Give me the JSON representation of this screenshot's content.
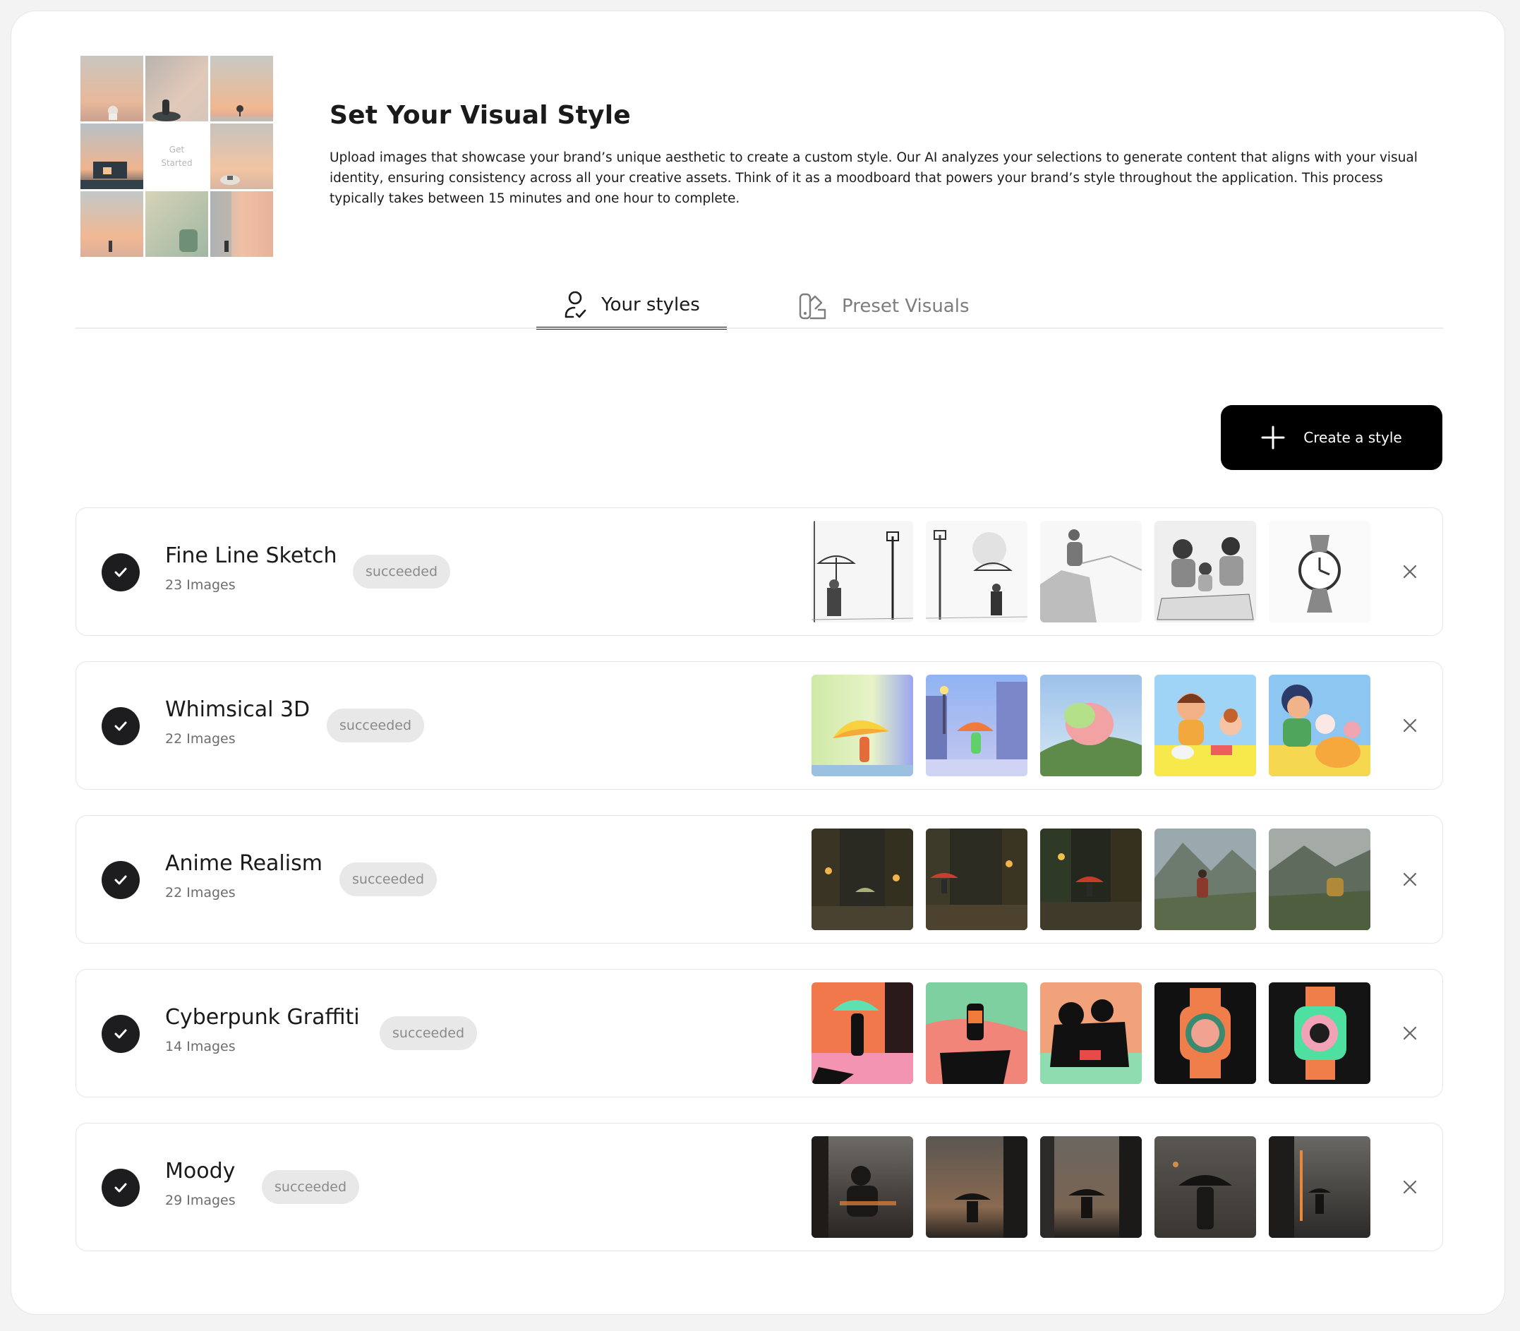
{
  "header": {
    "title": "Set Your Visual Style",
    "description": "Upload images that showcase your brand’s unique aesthetic to create a custom style. Our AI analyzes your selections to generate content that aligns with your visual identity, ensuring consistency across all your creative assets. Think of it as a moodboard that powers your brand’s style throughout the application. This process typically takes between 15 minutes and one hour to complete.",
    "hero_center_line1": "Get",
    "hero_center_line2": "Started"
  },
  "tabs": [
    {
      "label": "Your styles",
      "icon": "user-check-icon",
      "active": true
    },
    {
      "label": "Preset Visuals",
      "icon": "swatch-icon",
      "active": false
    }
  ],
  "actions": {
    "create_label": "Create a style"
  },
  "styles": [
    {
      "name": "Fine Line Sketch",
      "count": "23 Images",
      "status": "succeeded",
      "thumb_style": "sketch"
    },
    {
      "name": "Whimsical 3D",
      "count": "22 Images",
      "status": "succeeded",
      "thumb_style": "whimsical"
    },
    {
      "name": "Anime Realism",
      "count": "22 Images",
      "status": "succeeded",
      "thumb_style": "anime"
    },
    {
      "name": "Cyberpunk Graffiti",
      "count": "14 Images",
      "status": "succeeded",
      "thumb_style": "cyberpunk"
    },
    {
      "name": "Moody",
      "count": "29 Images",
      "status": "succeeded",
      "thumb_style": "moody"
    }
  ],
  "colors": {
    "accent": "#000000",
    "badge_bg": "#e8e8e8",
    "badge_text": "#8a8a8a",
    "check_bg": "#1d1d1f"
  }
}
